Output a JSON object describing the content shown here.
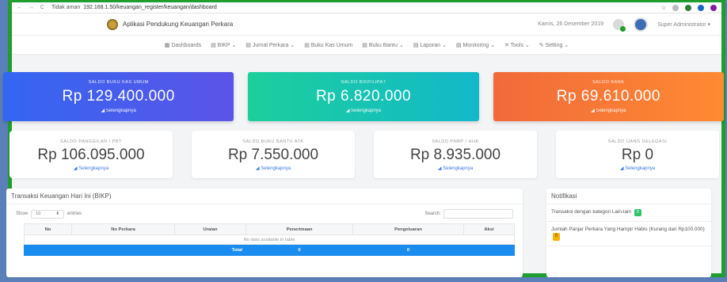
{
  "browser": {
    "nav": "← → C",
    "security": "Tidak aman",
    "url": "192.168.1.50/keuangan_register/keuangan/dashboard"
  },
  "header": {
    "app_title": "Aplikasi Pendukung Keuangan Perkara",
    "date": "Kamis, 26 Desember 2019",
    "user": "Super Administrator ▾"
  },
  "menu": [
    "▦ Dashboards",
    "▤ BIKP ⌄",
    "▤ Jurnal Perkara ⌄",
    "▤ Buku Kas Umum",
    "▤ Buku Bantu ⌄",
    "▤ Laporan ⌄",
    "▤ Monitoring ⌄",
    "✕ Tools ⌄",
    "✎ Setting ⌄"
  ],
  "top_cards": [
    {
      "label": "SALDO BUKU KAS UMUM",
      "value": "Rp 129.400.000",
      "more": "Selengkapnya"
    },
    {
      "label": "SALDO BIKP/LIPA7",
      "value": "Rp 6.820.000",
      "more": "Selengkapnya"
    },
    {
      "label": "SALDO BANK",
      "value": "Rp 69.610.000",
      "more": "Selengkapnya"
    }
  ],
  "mid_cards": [
    {
      "label": "SALDO PANGGILAN / PBT",
      "value": "Rp 106.095.000",
      "more": "Selengkapnya"
    },
    {
      "label": "SALDO BUKU BANTU ATK",
      "value": "Rp 7.550.000",
      "more": "Selengkapnya"
    },
    {
      "label": "SALDO PNBP / HHK",
      "value": "Rp 8.935.000",
      "more": "Selengkapnya"
    },
    {
      "label": "SALDO UANG DELEGASI",
      "value": "Rp 0",
      "more": "Selengkapnya"
    }
  ],
  "table_panel": {
    "title": "Transaksi Keuangan Hari Ini (BIKP)",
    "show": "Show",
    "entries_value": "10",
    "entries": "entries",
    "search": "Search:",
    "columns": [
      "No",
      "No Perkara",
      "Uraian",
      "Penerimaan",
      "Pengeluaran",
      "Aksi"
    ],
    "empty": "No data available in table",
    "total_label": "Total",
    "total_in": "0",
    "total_out": "0"
  },
  "notif": {
    "title": "Notifikasi",
    "items": [
      {
        "text": "Transaksi dengan kategori Lain-lain",
        "badge": "0"
      },
      {
        "text": "Jumlah Panjar Perkara Yang Hampir Habis (Kurang dari Rp100.000)",
        "badge": "0"
      }
    ]
  },
  "colors": {
    "border": "#1f9d2e",
    "blue": "#3366f2",
    "teal": "#1ccf9c",
    "orange": "#f16a3a"
  }
}
